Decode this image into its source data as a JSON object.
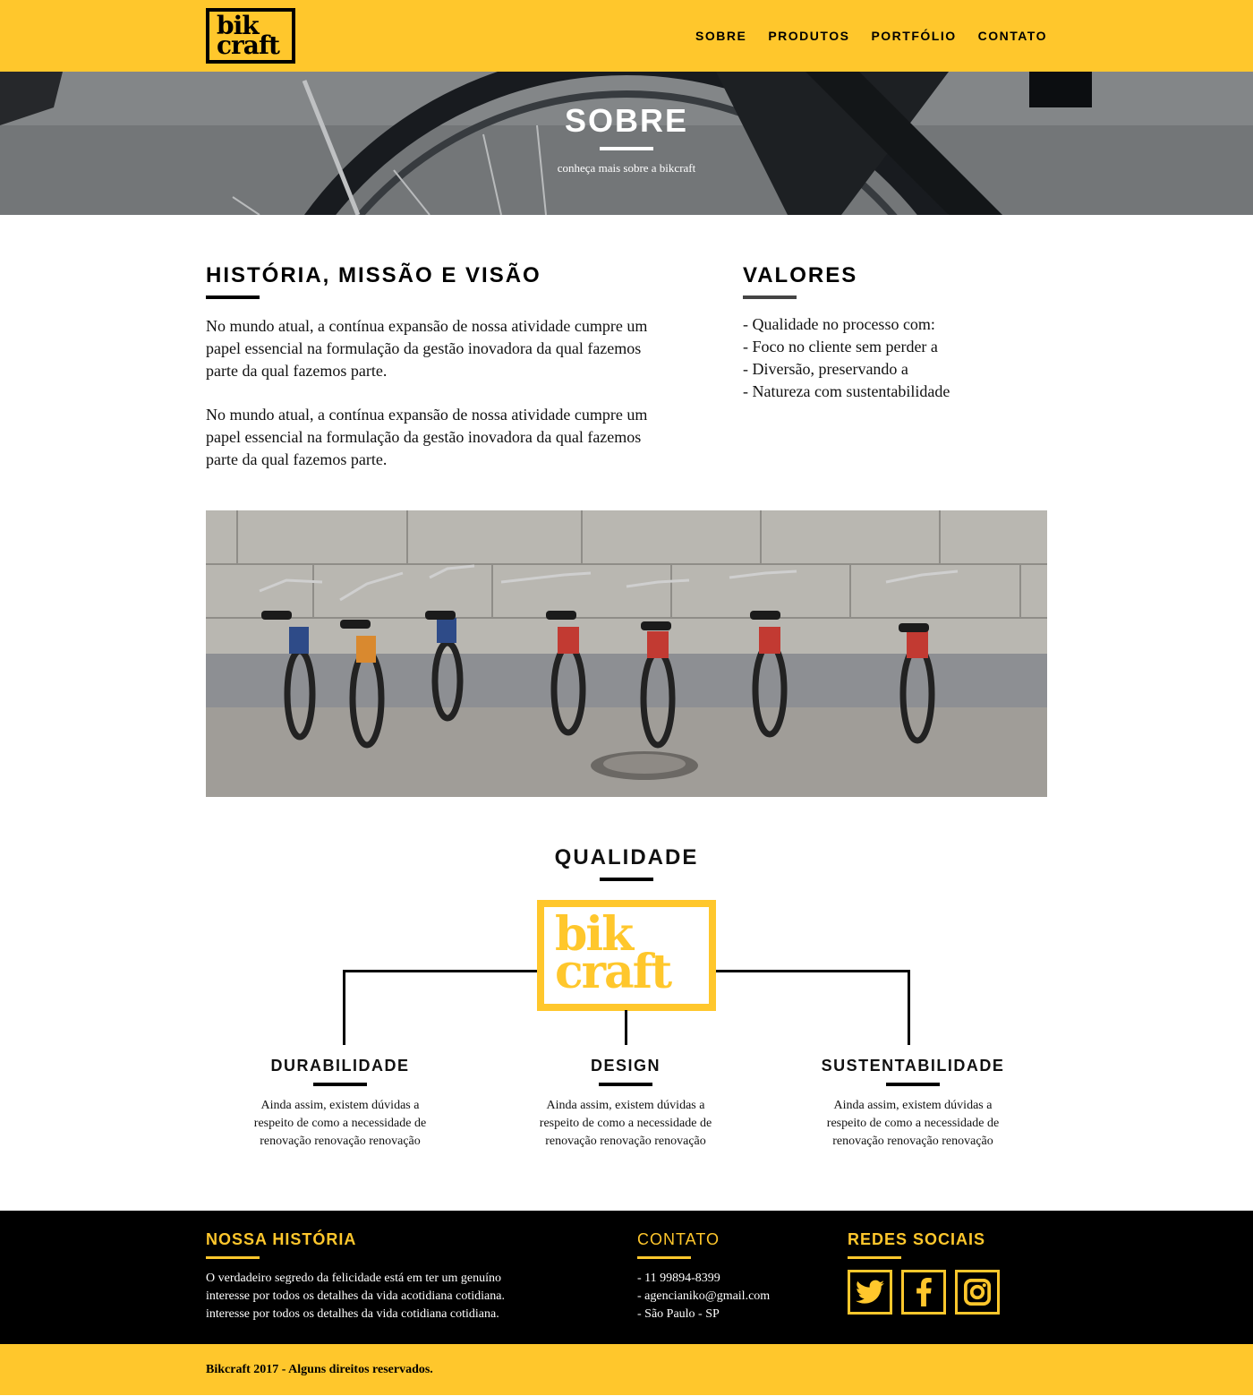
{
  "brand": {
    "logo_line1": "bik",
    "logo_line2": "craft"
  },
  "nav": [
    "SOBRE",
    "PRODUTOS",
    "PORTFÓLIO",
    "CONTATO"
  ],
  "hero": {
    "title": "SOBRE",
    "subtitle": "conheça mais sobre a bikcraft"
  },
  "about": {
    "history_title": "HISTÓRIA, MISSÃO E VISÃO",
    "paragraphs": [
      "No mundo atual, a contínua expansão de nossa atividade cumpre um papel essencial na formulação da gestão inovadora da qual fazemos parte da qual fazemos parte.",
      "No mundo atual, a contínua expansão de nossa atividade cumpre um papel essencial na formulação da gestão inovadora da qual fazemos parte da qual fazemos parte."
    ],
    "values_title": "VALORES",
    "values": [
      "- Qualidade no processo com:",
      "- Foco no cliente sem perder a",
      "- Diversão, preservando a",
      "- Natureza com sustentabilidade"
    ]
  },
  "quality": {
    "title": "QUALIDADE",
    "logo_line1": "bik",
    "logo_line2": "craft",
    "pillars": [
      {
        "title": "DURABILIDADE",
        "text": "Ainda assim, existem dúvidas a respeito de como a necessidade de renovação renovação renovação"
      },
      {
        "title": "DESIGN",
        "text": "Ainda assim, existem dúvidas a respeito de como a necessidade de renovação renovação renovação"
      },
      {
        "title": "SUSTENTABILIDADE",
        "text": "Ainda assim, existem dúvidas a respeito de como a necessidade de renovação renovação renovação"
      }
    ]
  },
  "footer": {
    "history_title": "NOSSA HISTÓRIA",
    "history_text": "O verdadeiro segredo da felicidade está em ter um genuíno interesse por todos os detalhes da vida acotidiana cotidiana. interesse por todos os detalhes da vida cotidiana cotidiana.",
    "contact_title": "CONTATO",
    "contact": [
      "- 11 99894-8399",
      "- agencianiko@gmail.com",
      "- São Paulo - SP"
    ],
    "social_title": "REDES SOCIAIS",
    "social_icons": [
      "twitter-icon",
      "facebook-icon",
      "instagram-icon"
    ]
  },
  "copyright": "Bikcraft 2017 - Alguns direitos reservados.",
  "colors": {
    "accent": "#ffc72c",
    "dark": "#000000",
    "text": "#111111"
  }
}
